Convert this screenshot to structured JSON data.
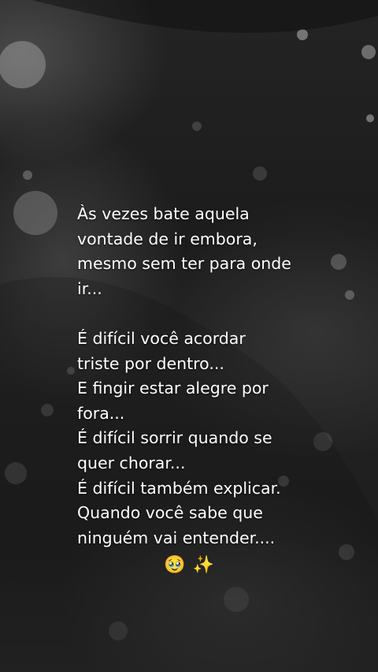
{
  "quote_lines": [
    "Às vezes bate aquela",
    "vontade de ir embora,",
    "mesmo sem ter para onde",
    "ir...",
    "",
    "É difícil você acordar",
    "triste por dentro...",
    "E fingir estar alegre por",
    "fora...",
    "É difícil sorrir quando se",
    "quer chorar...",
    "É difícil também explicar.",
    "Quando você sabe que",
    "ninguém vai entender...."
  ],
  "emojis": {
    "face": "🥹",
    "sparkles": "✨"
  }
}
